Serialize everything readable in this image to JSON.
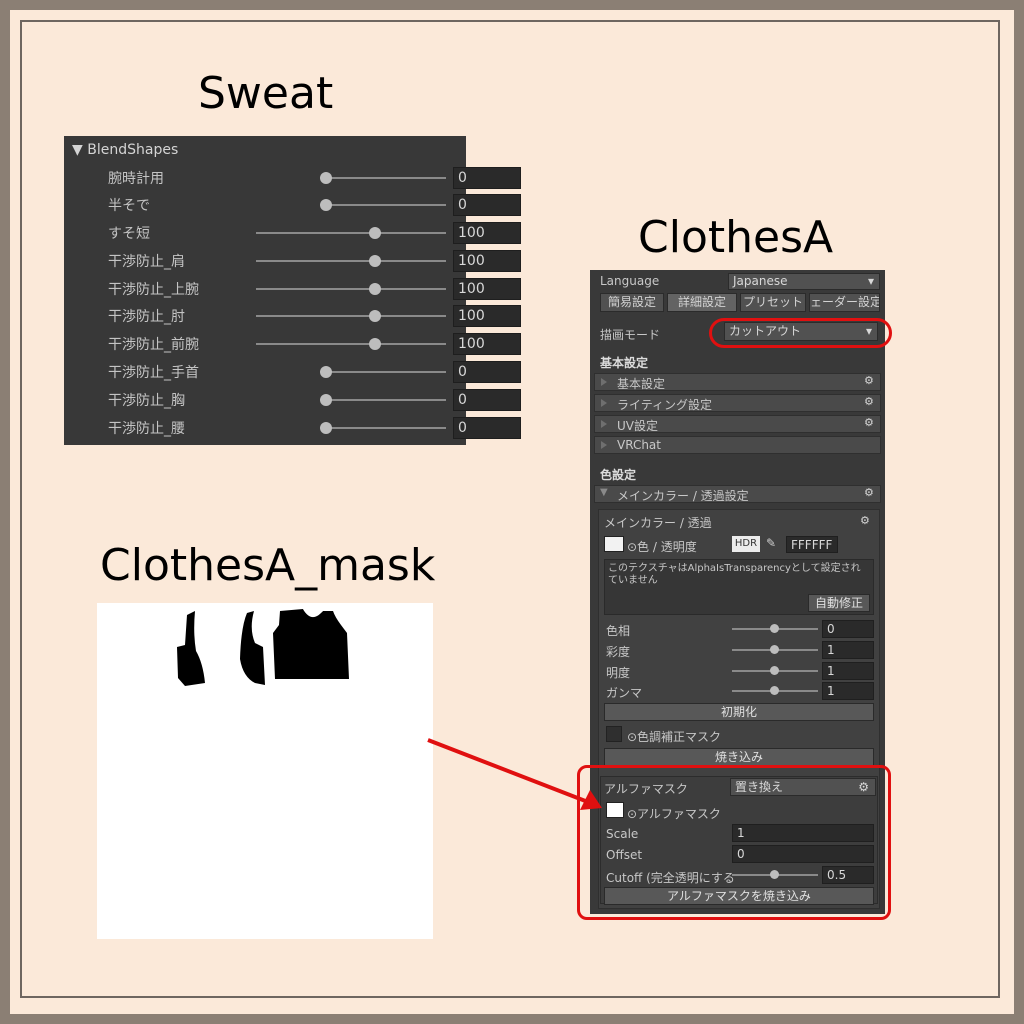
{
  "titles": {
    "sweat": "Sweat",
    "clothes": "ClothesA",
    "mask": "ClothesA_mask"
  },
  "blendshapes": {
    "header": "BlendShapes",
    "rows": [
      {
        "label": "腕時計用",
        "value": "0"
      },
      {
        "label": "半そで",
        "value": "0"
      },
      {
        "label": "すそ短",
        "value": "100"
      },
      {
        "label": "干渉防止_肩",
        "value": "100"
      },
      {
        "label": "干渉防止_上腕",
        "value": "100"
      },
      {
        "label": "干渉防止_肘",
        "value": "100"
      },
      {
        "label": "干渉防止_前腕",
        "value": "100"
      },
      {
        "label": "干渉防止_手首",
        "value": "0"
      },
      {
        "label": "干渉防止_胸",
        "value": "0"
      },
      {
        "label": "干渉防止_腰",
        "value": "0"
      }
    ]
  },
  "inspector": {
    "language_label": "Language",
    "language_value": "Japanese",
    "tabs": [
      "簡易設定",
      "詳細設定",
      "プリセット",
      "ェーダー設定"
    ],
    "render_mode_label": "描画モード",
    "render_mode_value": "カットアウト",
    "basic_header": "基本設定",
    "basic_groups": [
      "基本設定",
      "ライティング設定",
      "UV設定",
      "VRChat"
    ],
    "color_header": "色設定",
    "main_color_group": "メインカラー / 透過設定",
    "main_color_sub": "メインカラー / 透過",
    "color_alpha_label": "⊙色 / 透明度",
    "hdr": "HDR",
    "hex": "FFFFFF",
    "warning": "このテクスチャはAlphaIsTransparencyとして設定されていません",
    "autofix": "自動修正",
    "hue_label": "色相",
    "hue_value": "0",
    "sat_label": "彩度",
    "sat_value": "1",
    "bright_label": "明度",
    "bright_value": "1",
    "gamma_label": "ガンマ",
    "gamma_value": "1",
    "reset": "初期化",
    "tone_mask": "⊙色調補正マスク",
    "bake": "焼き込み",
    "alpha_mask_label": "アルファマスク",
    "alpha_mask_mode": "置き換え",
    "alpha_mask_tex": "⊙アルファマスク",
    "scale_label": "Scale",
    "scale_value": "1",
    "offset_label": "Offset",
    "offset_value": "0",
    "cutoff_label": "Cutoff (完全透明にする",
    "cutoff_value": "0.5",
    "bake_alpha": "アルファマスクを焼き込み"
  },
  "colors": {
    "annotation": "#e01010",
    "background": "#fbe9d9"
  }
}
